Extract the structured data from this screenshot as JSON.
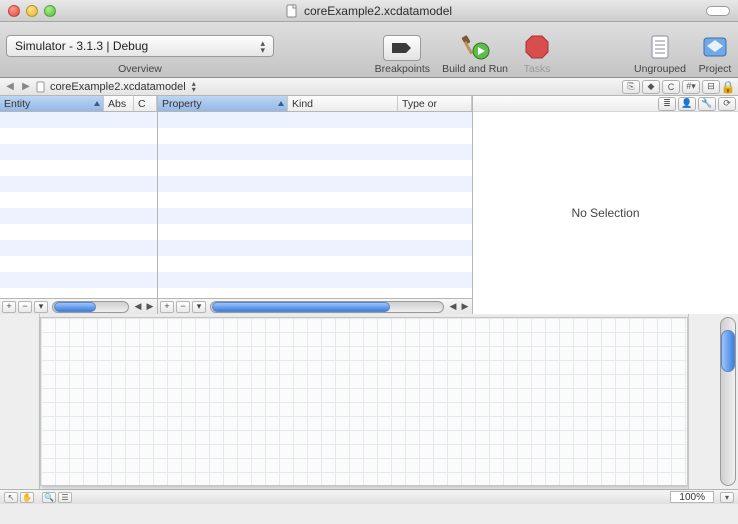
{
  "window": {
    "title": "coreExample2.xcdatamodel"
  },
  "toolbar": {
    "overview_label": "Overview",
    "overview_value": "Simulator - 3.1.3 | Debug",
    "breakpoints": "Breakpoints",
    "build_and_run": "Build and Run",
    "tasks": "Tasks",
    "ungrouped": "Ungrouped",
    "project": "Project"
  },
  "pathbar": {
    "filename": "coreExample2.xcdatamodel"
  },
  "entity_table": {
    "col_entity": "Entity",
    "col_abs": "Abs",
    "col_c": "C"
  },
  "property_table": {
    "col_property": "Property",
    "col_kind": "Kind",
    "col_type": "Type or"
  },
  "detail": {
    "no_selection": "No Selection"
  },
  "statusbar": {
    "zoom": "100%"
  }
}
